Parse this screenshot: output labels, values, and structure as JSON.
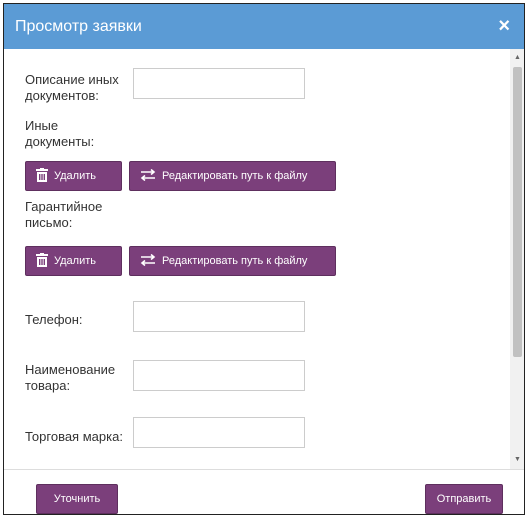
{
  "dialog": {
    "title": "Просмотр заявки",
    "close_glyph": "×"
  },
  "fields": {
    "other_docs_desc_label": "Описание иных документов:",
    "other_docs_label": "Иные документы:",
    "guarantee_label": "Гарантийное письмо:",
    "phone_label": "Телефон:",
    "product_name_label": "Наименование товара:",
    "trademark_label": "Торговая марка:"
  },
  "buttons": {
    "delete": "Удалить",
    "edit_path": "Редактировать путь к файлу",
    "clarify": "Уточнить",
    "send": "Отправить"
  },
  "icons": {
    "trash": "trash-icon",
    "swap": "swap-arrows-icon",
    "scroll_up": "scroll-up-icon",
    "scroll_down": "scroll-down-icon"
  },
  "colors": {
    "header": "#5b9bd5",
    "button": "#7b3f7b",
    "scrollbar_thumb": "#c1c1c1"
  }
}
